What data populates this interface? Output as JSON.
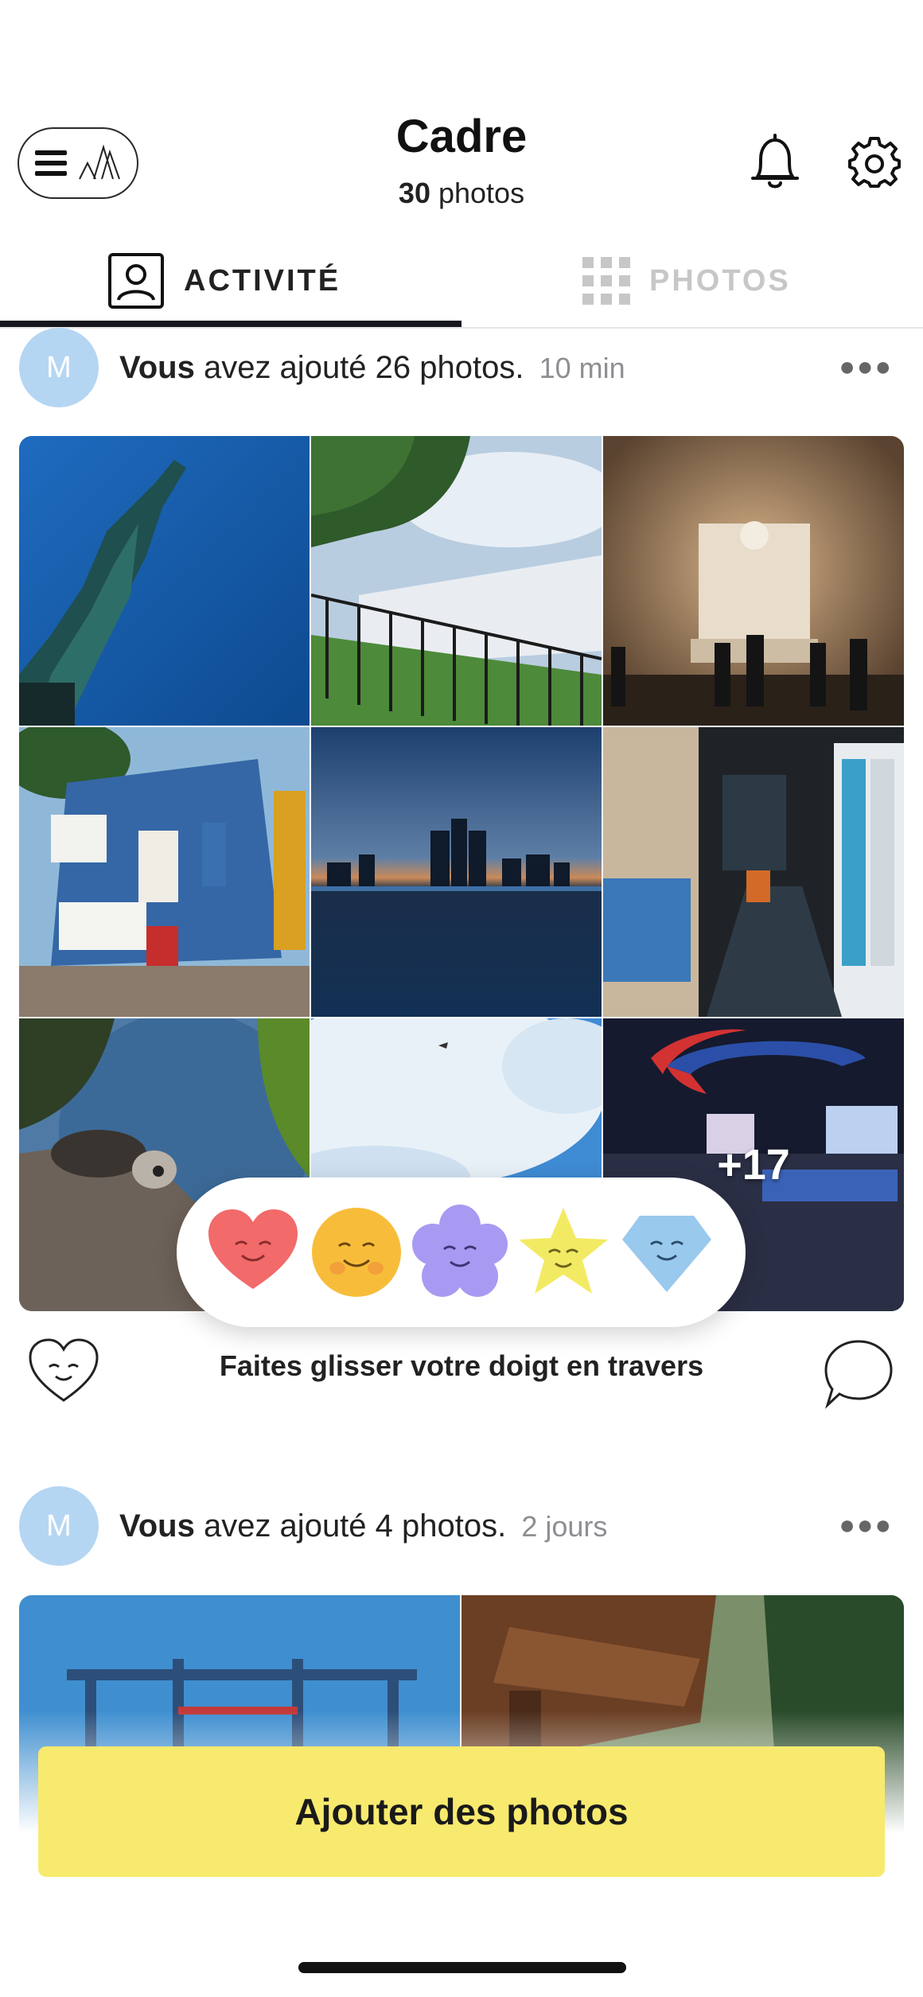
{
  "header": {
    "title": "Cadre",
    "photo_count": "30",
    "photo_count_label": "photos"
  },
  "tabs": [
    {
      "label": "ACTIVITÉ",
      "icon": "person-icon",
      "active": true
    },
    {
      "label": "PHOTOS",
      "icon": "grid-icon",
      "active": false
    }
  ],
  "posts": [
    {
      "avatar_letter": "M",
      "who": "Vous",
      "text": "avez ajouté 26 photos.",
      "time": "10 min",
      "more_count": "+17"
    },
    {
      "avatar_letter": "M",
      "who": "Vous",
      "text": "avez ajouté 4 photos.",
      "time": "2 jours"
    }
  ],
  "reactions": [
    "heart",
    "smile-face",
    "flower",
    "star",
    "diamond"
  ],
  "actions": {
    "swipe_hint": "Faites glisser votre doigt en travers"
  },
  "cta": {
    "label": "Ajouter des photos"
  },
  "colors": {
    "accent_yellow": "#f8ea6e",
    "avatar_blue": "#b5d6f2",
    "tab_inactive": "#c7c7c7"
  }
}
